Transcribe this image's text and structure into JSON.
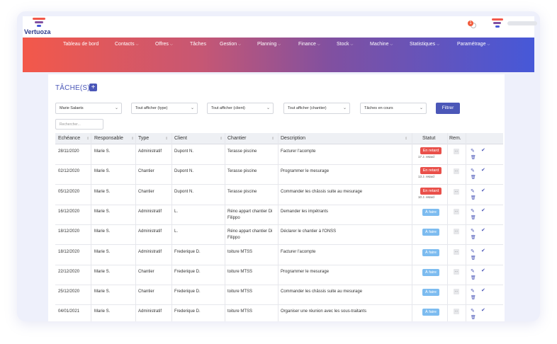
{
  "app": {
    "brand": "Vertuoza",
    "notification_count": "1",
    "brand_colors": [
      "#f3584a",
      "#4658d8"
    ]
  },
  "nav": {
    "items": [
      {
        "label": "Tableau de bord",
        "dropdown": false
      },
      {
        "label": "Contacts",
        "dropdown": true
      },
      {
        "label": "Offres",
        "dropdown": true
      },
      {
        "label": "Tâches",
        "dropdown": false
      },
      {
        "label": "Gestion",
        "dropdown": true
      },
      {
        "label": "Planning",
        "dropdown": true
      },
      {
        "label": "Finance",
        "dropdown": true
      },
      {
        "label": "Stock",
        "dropdown": true
      },
      {
        "label": "Machine",
        "dropdown": true
      },
      {
        "label": "Statistiques",
        "dropdown": true
      },
      {
        "label": "Paramétrage",
        "dropdown": true
      }
    ]
  },
  "page": {
    "title": "TÂCHE(S)",
    "add_icon": "plus-icon"
  },
  "filters": {
    "user": "Marie Salaets",
    "type": "Tout afficher (type)",
    "client": "Tout afficher (client)",
    "chantier": "Tout afficher (chantier)",
    "status": "Tâches en cours",
    "filter_button": "Filtrer",
    "search_placeholder": "Rechercher..."
  },
  "table": {
    "columns": [
      "Echéance",
      "Responsable",
      "Type",
      "Client",
      "Chantier",
      "Description",
      "Statut",
      "Rem."
    ],
    "rows": [
      {
        "due": "28/11/2020",
        "owner": "Marie S.",
        "type": "Administratif",
        "client": "Dupont N.",
        "site": "Terasse piscine",
        "desc": "Facturer l'acompte",
        "status": "En retard",
        "status_kind": "late",
        "delay": "17 J. retard"
      },
      {
        "due": "02/12/2020",
        "owner": "Marie S.",
        "type": "Chantier",
        "client": "Dupont N.",
        "site": "Terasse piscine",
        "desc": "Programmer le mesurage",
        "status": "En retard",
        "status_kind": "late",
        "delay": "13 J. retard"
      },
      {
        "due": "05/12/2020",
        "owner": "Marie S.",
        "type": "Chantier",
        "client": "Dupont N.",
        "site": "Terasse piscine",
        "desc": "Commander les châssis suite au mesurage",
        "status": "En retard",
        "status_kind": "late",
        "delay": "10 J. retard"
      },
      {
        "due": "16/12/2020",
        "owner": "Marie S.",
        "type": "Administratif",
        "client": "L.",
        "site": "Réno appart chantier Di Filippo",
        "desc": "Demander les impétrants",
        "status": "À faire",
        "status_kind": "todo",
        "delay": ""
      },
      {
        "due": "18/12/2020",
        "owner": "Marie S.",
        "type": "Administratif",
        "client": "L.",
        "site": "Réno appart chantier Di Filippo",
        "desc": "Déclarer le chantier à l'ONSS",
        "status": "À faire",
        "status_kind": "todo",
        "delay": ""
      },
      {
        "due": "18/12/2020",
        "owner": "Marie S.",
        "type": "Administratif",
        "client": "Frederique D.",
        "site": "toiture MTSS",
        "desc": "Facturer l'acompte",
        "status": "À faire",
        "status_kind": "todo",
        "delay": ""
      },
      {
        "due": "22/12/2020",
        "owner": "Marie S.",
        "type": "Chantier",
        "client": "Frederique D.",
        "site": "toiture MTSS",
        "desc": "Programmer le mesurage",
        "status": "À faire",
        "status_kind": "todo",
        "delay": ""
      },
      {
        "due": "25/12/2020",
        "owner": "Marie S.",
        "type": "Chantier",
        "client": "Frederique D.",
        "site": "toiture MTSS",
        "desc": "Commander les châssis suite au mesurage",
        "status": "À faire",
        "status_kind": "todo",
        "delay": ""
      },
      {
        "due": "04/01/2021",
        "owner": "Marie S.",
        "type": "Administratif",
        "client": "Frederique D.",
        "site": "toiture MTSS",
        "desc": "Organiser une réunion avec les sous-traitants",
        "status": "À faire",
        "status_kind": "todo",
        "delay": ""
      }
    ],
    "rem_label": "...",
    "status_colors": {
      "late": "#e9504a",
      "todo": "#7dbcf0"
    }
  }
}
